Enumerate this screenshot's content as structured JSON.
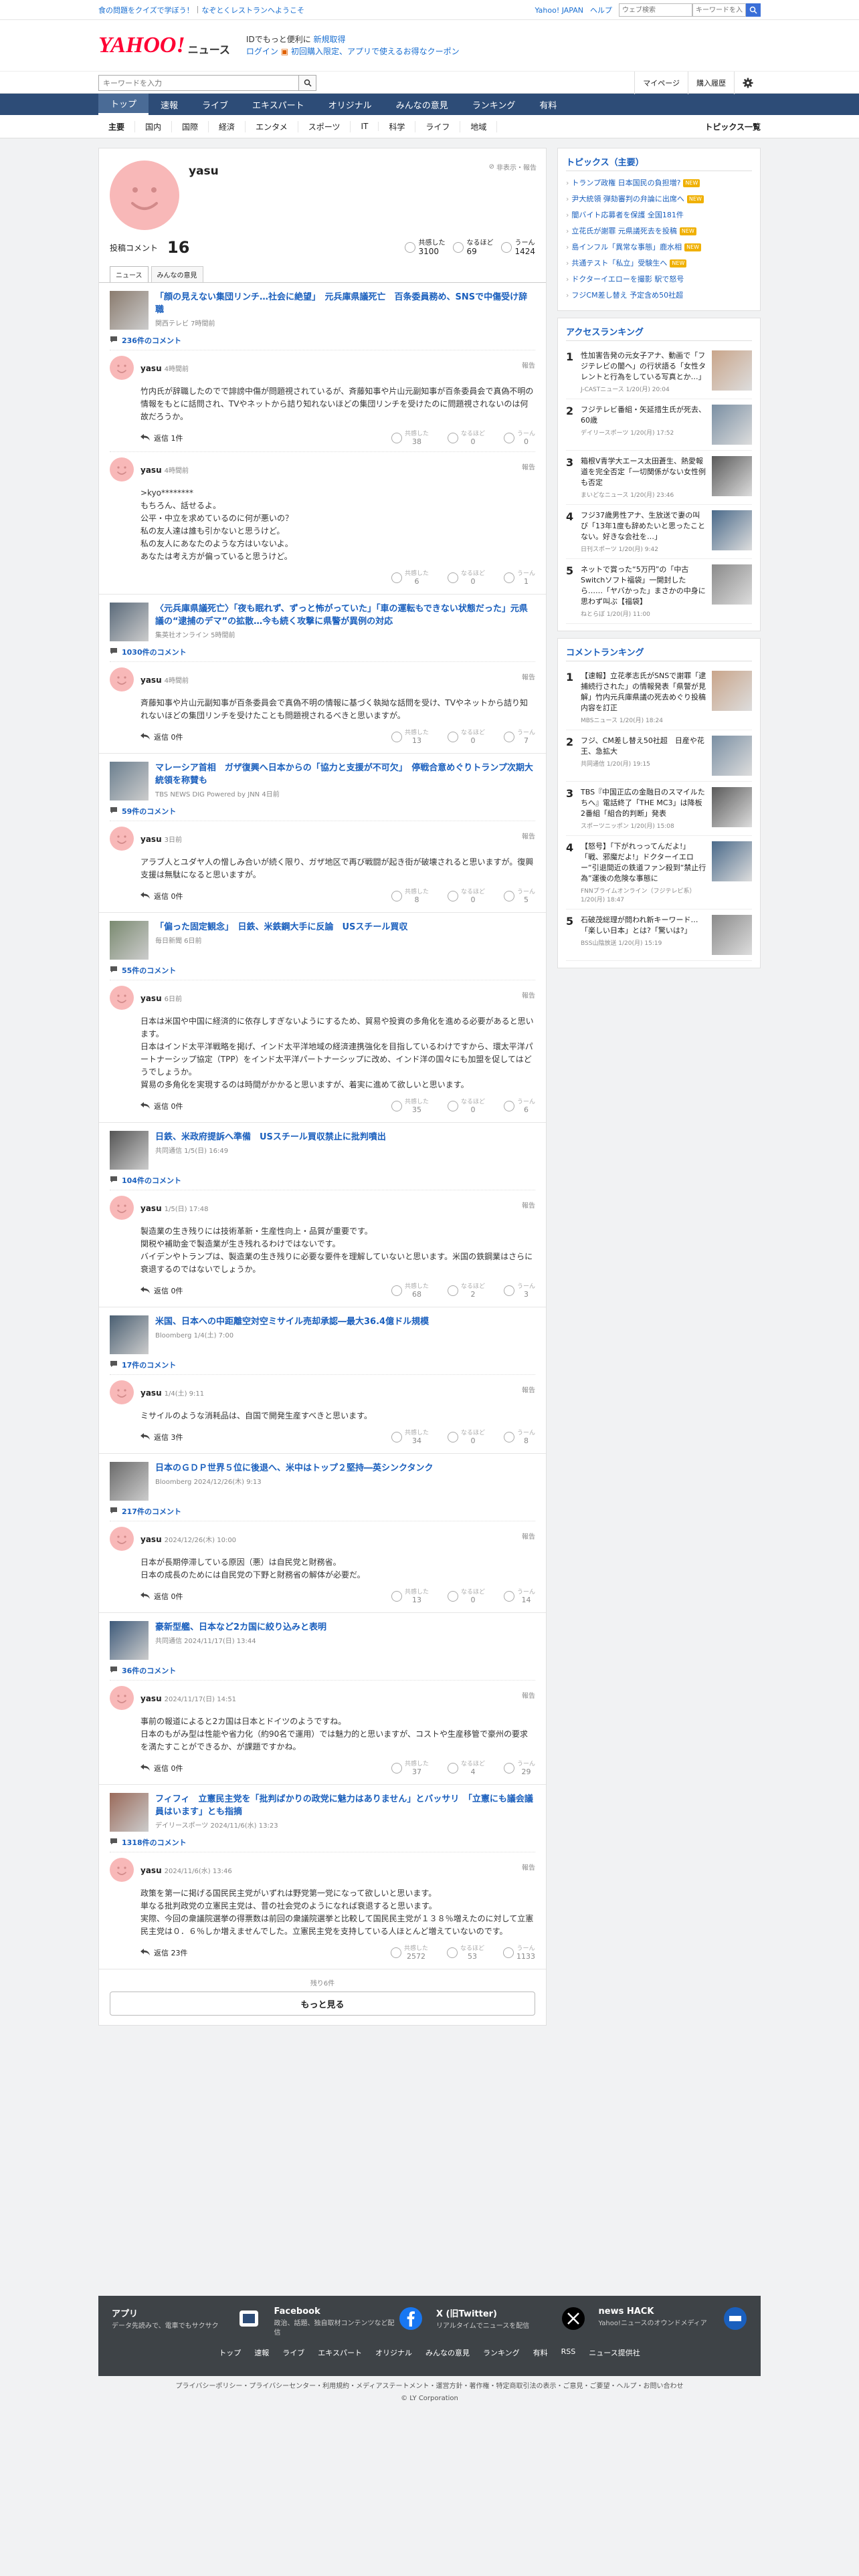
{
  "topbar": {
    "quiz": "食の問題をクイズで学ぼう！",
    "restaurant": "なぞとくレストランへようこそ",
    "yahoo_japan": "Yahoo! JAPAN",
    "help": "ヘルプ",
    "search_placeholder": "ウェブ検索",
    "search_btn_label": "キーワードを入力"
  },
  "masthead": {
    "logo": "YAHOO!",
    "logo_sub": "JAPAN",
    "service": "ニュース",
    "promo_line1_a": "IDでもっと便利に",
    "promo_line1_b": "新規取得",
    "promo_line2_a": "ログイン",
    "promo_line2_b": "初回購入限定、アプリで使えるお得なクーポン"
  },
  "search": {
    "placeholder": "キーワードを入力",
    "mypage": "マイページ",
    "history": "購入履歴"
  },
  "gnav": [
    "トップ",
    "速報",
    "ライブ",
    "エキスパート",
    "オリジナル",
    "みんなの意見",
    "ランキング",
    "有料"
  ],
  "subnav": [
    "主要",
    "国内",
    "国際",
    "経済",
    "エンタメ",
    "スポーツ",
    "IT",
    "科学",
    "ライフ",
    "地域"
  ],
  "subnav_right": "トピックス一覧",
  "profile": {
    "name": "yasu",
    "hide": "非表示・報告",
    "count_label": "投稿コメント",
    "count": "16",
    "reactions": [
      {
        "label": "共感した",
        "value": "3100"
      },
      {
        "label": "なるほど",
        "value": "69"
      },
      {
        "label": "うーん",
        "value": "1424"
      }
    ],
    "tabs": [
      "ニュース",
      "みんなの意見"
    ]
  },
  "labels": {
    "report": "報告",
    "kyokan": "共感した",
    "naruhodo": "なるほど",
    "uun": "うーん"
  },
  "items": [
    {
      "title": "「顔の見えない集団リンチ…社会に絶望」　元兵庫県議死亡　百条委員務め、SNSで中傷受け辞職",
      "source": "関西テレビ 7時間前",
      "count": "236件のコメント",
      "comments": [
        {
          "name": "yasu",
          "time": "4時間前",
          "text": "竹内氏が辞職したのでで誹謗中傷が問題視されているが、斉藤知事や片山元副知事が百条委員会で真偽不明の情報をもとに話問され、TVやネットから詰り知れないほどの集団リンチを受けたのに問題視されないのは何故だろうか。",
          "reply": "返信 1件",
          "r": [
            "38",
            "0",
            "0"
          ]
        },
        {
          "name": "yasu",
          "time": "4時間前",
          "text": ">kyo********\nもちろん、話せるよ。\n公平・中立を求めているのに何が悪いの？\n私の友人達は誰も引かないと思うけど。\n私の友人にあなたのような方はいないよ。\nあなたは考え方が偏っていると思うけど。",
          "reply": "",
          "r": [
            "6",
            "0",
            "1"
          ]
        }
      ]
    },
    {
      "title": "〈元兵庫県議死亡〉「夜も眠れず、ずっと怖がっていた」「車の運転もできない状態だった」元県議の“逮捕のデマ”の拡散…今も続く攻撃に県警が異例の対応",
      "source": "集英社オンライン 5時間前",
      "count": "1030件のコメント",
      "comments": [
        {
          "name": "yasu",
          "time": "4時間前",
          "text": "斉藤知事や片山元副知事が百条委員会で真偽不明の情報に基づく執拗な話問を受け、TVやネットから詰り知れないほどの集団リンチを受けたことも問題視されるべきと思いますが。",
          "reply": "返信 0件",
          "r": [
            "13",
            "0",
            "7"
          ]
        }
      ]
    },
    {
      "title": "マレーシア首相　ガザ復興へ日本からの「協力と支援が不可欠」　停戦合意めぐりトランプ次期大統領を称賛も",
      "source": "TBS NEWS DIG Powered by JNN 4日前",
      "count": "59件のコメント",
      "comments": [
        {
          "name": "yasu",
          "time": "3日前",
          "text": "アラブ人とユダヤ人の憎しみ合いが続く限り、ガザ地区で再び戦闘が起き街が破壊されると思いますが。復興支援は無駄になると思いますが。",
          "reply": "返信 0件",
          "r": [
            "8",
            "0",
            "5"
          ]
        }
      ]
    },
    {
      "title": "「偏った固定観念」　日鉄、米鉄鋼大手に反論　USスチール買収",
      "source": "毎日新聞 6日前",
      "count": "55件のコメント",
      "comments": [
        {
          "name": "yasu",
          "time": "6日前",
          "text": "日本は米国や中国に経済的に依存しすぎないようにするため、貿易や投資の多角化を進める必要があると思います。\n日本はインド太平洋戦略を掲げ、インド太平洋地域の経済連携強化を目指しているわけですから、環太平洋パートナーシップ協定（TPP）をインド太平洋パートナーシップに改め、インド洋の国々にも加盟を促してはどうでしょうか。\n貿易の多角化を実現するのは時間がかかると思いますが、着実に進めて欲しいと思います。",
          "reply": "返信 0件",
          "r": [
            "35",
            "0",
            "6"
          ]
        }
      ]
    },
    {
      "title": "日鉄、米政府提訴へ準備　USスチール買収禁止に批判噴出",
      "source": "共同通信 1/5(日) 16:49",
      "count": "104件のコメント",
      "comments": [
        {
          "name": "yasu",
          "time": "1/5(日) 17:48",
          "text": "製造業の生き残りには技術革新・生産性向上・品質が重要です。\n関税や補助金で製造業が生き残れるわけではないです。\nバイデンやトランプは、製造業の生き残りに必要な要件を理解していないと思います。米国の鉄鋼業はさらに衰退するのではないでしょうか。",
          "reply": "返信 0件",
          "r": [
            "68",
            "2",
            "3"
          ]
        }
      ]
    },
    {
      "title": "米国、日本への中距離空対空ミサイル売却承認―最大36.4億ドル規模",
      "source": "Bloomberg 1/4(土) 7:00",
      "count": "17件のコメント",
      "comments": [
        {
          "name": "yasu",
          "time": "1/4(土) 9:11",
          "text": "ミサイルのような消耗品は、自国で開発生産すべきと思います。",
          "reply": "返信 3件",
          "r": [
            "34",
            "0",
            "8"
          ]
        }
      ]
    },
    {
      "title": "日本のＧＤＰ世界５位に後退へ、米中はトップ２堅持―英シンクタンク",
      "source": "Bloomberg 2024/12/26(木) 9:13",
      "count": "217件のコメント",
      "comments": [
        {
          "name": "yasu",
          "time": "2024/12/26(木) 10:00",
          "text": "日本が長期停滞している原因（悪）は自民党と財務省。\n日本の成長のためには自民党の下野と財務省の解体が必要だ。",
          "reply": "返信 0件",
          "r": [
            "13",
            "0",
            "14"
          ]
        }
      ]
    },
    {
      "title": "豪新型艦、日本など2カ国に絞り込みと表明",
      "source": "共同通信 2024/11/17(日) 13:44",
      "count": "36件のコメント",
      "comments": [
        {
          "name": "yasu",
          "time": "2024/11/17(日) 14:51",
          "text": "事前の報道によると2カ国は日本とドイツのようですね。\n日本のもがみ型は性能や省力化（約90名で運用）では魅力的と思いますが、コストや生産移管で豪州の要求を満たすことができるか、が課題ですかね。",
          "reply": "返信 0件",
          "r": [
            "37",
            "4",
            "29"
          ]
        }
      ]
    },
    {
      "title": "フィフィ　立憲民主党を「批判ばかりの政党に魅力はありません」とバッサリ　「立憲にも議会議員はいます」とも指摘",
      "source": "デイリースポーツ 2024/11/6(水) 13:23",
      "count": "1318件のコメント",
      "comments": [
        {
          "name": "yasu",
          "time": "2024/11/6(水) 13:46",
          "text": "政策を第一に掲げる国民民主党がいずれは野党第一党になって欲しいと思います。\n単なる批判政党の立憲民主党は、昔の社会党のようになれば衰退すると思います。\n実際、今回の衆議院選挙の得票数は前回の衆議院選挙と比較して国民民主党が１３８％増えたのに対して立憲民主党は０．６％しか増えませんでした。立憲民主党を支持している人ほとんど増えていないのです。",
          "reply": "返信 23件",
          "r": [
            "2572",
            "53",
            "1133"
          ]
        }
      ]
    }
  ],
  "remain": "残り6件",
  "more": "もっと見る",
  "side": {
    "topics_head": "トピックス（主要）",
    "topics": [
      {
        "t": "トランプ政権 日本国民の負担増?",
        "badge": "NEW"
      },
      {
        "t": "尹大統領 弾劾審判の弁論に出席へ",
        "badge": "NEW"
      },
      {
        "t": "闇バイト応募者を保護 全国181件",
        "badge": ""
      },
      {
        "t": "立花氏が謝罪 元県議死去を投稿",
        "badge": "NEW"
      },
      {
        "t": "島インフル「異常な事態」鹿水相",
        "badge": "NEW"
      },
      {
        "t": "共通テスト「私立」受験生へ",
        "badge": "NEW"
      },
      {
        "t": "ドクターイエローを撮影 駅で怒号",
        "badge": ""
      },
      {
        "t": "フジCM差し替え 予定含め50社超",
        "badge": ""
      }
    ],
    "access_head": "アクセスランキング",
    "access": [
      {
        "no": "1",
        "t": "性加害告発の元女子アナ、動画で「フジテレビの闇ヘ」の行状語る「女性タレントと行為をしている写真とか…」",
        "s": "J-CASTニュース 1/20(月) 20:04"
      },
      {
        "no": "2",
        "t": "フジテレビ番組・矢延措生氏が死去、60歳",
        "s": "デイリースポーツ 1/20(月) 17:52"
      },
      {
        "no": "3",
        "t": "箱根V青学大エース太田蒼生、熱愛報道を完全否定「一切関係がない女性例も否定",
        "s": "まいどなニュース 1/20(月) 23:46"
      },
      {
        "no": "4",
        "t": "フジ37歳男性アナ、生放送で妻の叫び「13年1度も辞めたいと思ったことない。好きな会社を…」",
        "s": "日刊スポーツ 1/20(月) 9:42"
      },
      {
        "no": "5",
        "t": "ネットで賞った“5万円”の「中古Switchソフト福袋」一開封したら……「ヤバかった」まさかの中身に思わず叫ぶ【福袋】",
        "s": "ねとらぼ 1/20(月) 11:00"
      }
    ],
    "comment_head": "コメントランキング",
    "comments": [
      {
        "no": "1",
        "t": "【速報】立花孝志氏がSNSで謝罪「逮捕続行された」の情報発表「県警が見解」竹内元兵庫県議の死去めぐり投稿内容を訂正",
        "s": "MBSニュース 1/20(月) 18:24"
      },
      {
        "no": "2",
        "t": "フジ、CM差し替え50社超　日産や花王、急拡大",
        "s": "共同通信 1/20(月) 19:15"
      },
      {
        "no": "3",
        "t": "TBS『中国正広の金融日のスマイルたちへ』電話終了「THE MC3」は降板　2番組「組合的判断」発表",
        "s": "スポーツニッポン 1/20(月) 15:08"
      },
      {
        "no": "4",
        "t": "【怒号】「下がれっってんだよ!」「戦、邪魔だよ!」ドクターイエロー“引退間近の鉄道ファン殺到“禁止行為”運後の危険な事態に",
        "s": "FNNプライムオンライン（フジテレビ系） 1/20(月) 18:47"
      },
      {
        "no": "5",
        "t": "石破茂総理が問われ新キーワード…「楽しい日本」とは?「驚いは?」",
        "s": "BSS山陰放送 1/20(月) 15:19"
      }
    ]
  },
  "footer": {
    "cards": [
      {
        "t": "アプリ",
        "d": "データ先読みで、電車でもサクサク"
      },
      {
        "t": "Facebook",
        "d": "政治、話題、独自取材コンテンツなど配信"
      },
      {
        "t": "X (旧Twitter)",
        "d": "リアルタイムでニュースを配信"
      },
      {
        "t": "news HACK",
        "d": "Yahoo!ニュースのオウンドメディア"
      }
    ],
    "links": [
      "トップ",
      "速報",
      "ライブ",
      "エキスパート",
      "オリジナル",
      "みんなの意見",
      "ランキング",
      "有料",
      "RSS",
      "ニュース提供社"
    ],
    "legal": "プライバシーポリシー・プライバシーセンター・利用規約・メディアステートメント・運営方針・著作権・特定商取引法の表示・ご意見・ご要望・ヘルプ・お問い合わせ",
    "copyright": "© LY Corporation"
  },
  "colors": {
    "accent": "#1a5fbd",
    "nav": "#2d4c77",
    "badge": "#f0b000",
    "avatar": "#f8b8b8"
  }
}
